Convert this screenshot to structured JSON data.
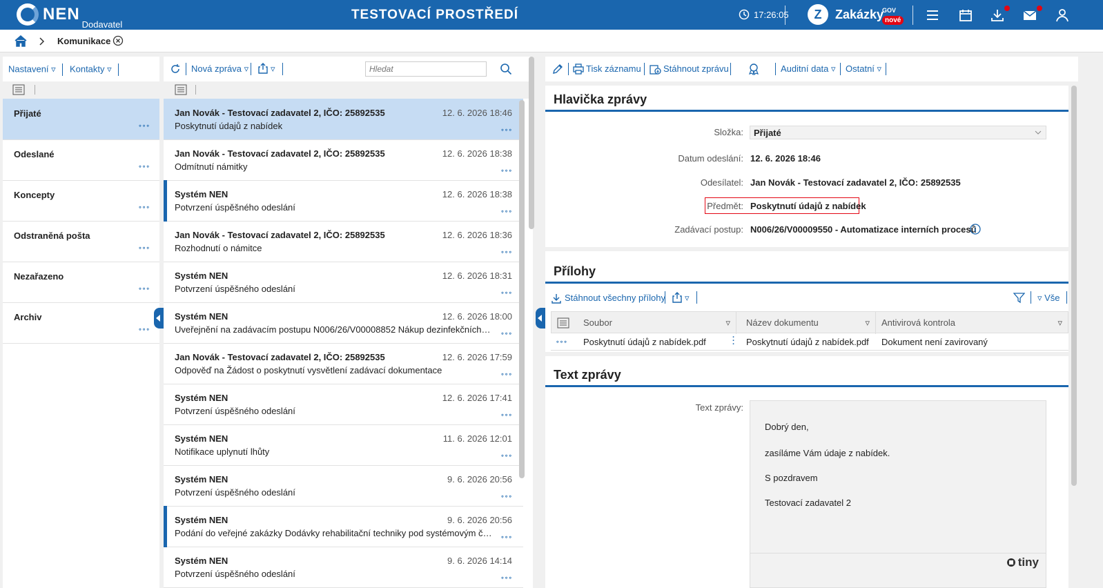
{
  "header": {
    "logo_text": "NEN",
    "logo_sub": "Dodavatel",
    "env_title": "TESTOVACÍ PROSTŘEDÍ",
    "clock": "17:26:05",
    "zakazky_text": "Zakázky",
    "zakazky_gov": "GOV",
    "zakazky_badge": "nové"
  },
  "breadcrumb": {
    "current": "Komunikace"
  },
  "left": {
    "toolbar": {
      "settings": "Nastavení",
      "contacts": "Kontakty"
    },
    "folders": [
      {
        "label": "Přijaté"
      },
      {
        "label": "Odeslané"
      },
      {
        "label": "Koncepty"
      },
      {
        "label": "Odstraněná pošta"
      },
      {
        "label": "Nezařazeno"
      },
      {
        "label": "Archiv"
      }
    ],
    "dots": "∘∘∘"
  },
  "middle": {
    "toolbar": {
      "new_message": "Nová zpráva",
      "search_placeholder": "Hledat"
    },
    "messages": [
      {
        "sender": "Jan Novák - Testovací zadavatel 2, IČO: 25892535",
        "date": "12. 6. 2026 18:46",
        "subject": "Poskytnutí údajů z nabídek"
      },
      {
        "sender": "Jan Novák - Testovací zadavatel 2, IČO: 25892535",
        "date": "12. 6. 2026 18:38",
        "subject": "Odmítnutí námitky"
      },
      {
        "sender": "Systém NEN",
        "date": "12. 6. 2026 18:38",
        "subject": "Potvrzení úspěšného odeslání"
      },
      {
        "sender": "Jan Novák - Testovací zadavatel 2, IČO: 25892535",
        "date": "12. 6. 2026 18:36",
        "subject": "Rozhodnutí o námitce"
      },
      {
        "sender": "Systém NEN",
        "date": "12. 6. 2026 18:31",
        "subject": "Potvrzení úspěšného odeslání"
      },
      {
        "sender": "Systém NEN",
        "date": "12. 6. 2026 18:00",
        "subject": "Uveřejnění na zadávacím postupu N006/26/V00008852 Nákup dezinfekčních prostředků"
      },
      {
        "sender": "Jan Novák - Testovací zadavatel 2, IČO: 25892535",
        "date": "12. 6. 2026 17:59",
        "subject": "Odpověď na Žádost o poskytnutí vysvětlení zadávací dokumentace"
      },
      {
        "sender": "Systém NEN",
        "date": "12. 6. 2026 17:41",
        "subject": "Potvrzení úspěšného odeslání"
      },
      {
        "sender": "Systém NEN",
        "date": "11. 6. 2026 12:01",
        "subject": "Notifikace uplynutí lhůty"
      },
      {
        "sender": "Systém NEN",
        "date": "9. 6. 2026 20:56",
        "subject": "Potvrzení úspěšného odeslání"
      },
      {
        "sender": "Systém NEN",
        "date": "9. 6. 2026 20:56",
        "subject": "Podání do veřejné zakázky Dodávky rehabilitační techniky pod systémovým číslem"
      },
      {
        "sender": "Systém NEN",
        "date": "9. 6. 2026 14:14",
        "subject": "Potvrzení úspěšného odeslání"
      }
    ]
  },
  "right": {
    "toolbar": {
      "print": "Tisk záznamu",
      "download": "Stáhnout zprávu",
      "audit": "Auditní data",
      "other": "Ostatní"
    },
    "header_section": {
      "title": "Hlavička zprávy",
      "folder_label": "Složka:",
      "folder_value": "Přijaté",
      "date_label": "Datum odeslání:",
      "date_value": "12. 6. 2026 18:46",
      "sender_label": "Odesílatel:",
      "sender_value": "Jan Novák - Testovací zadavatel 2, IČO: 25892535",
      "subject_label": "Předmět:",
      "subject_value": "Poskytnutí údajů z nabídek",
      "procedure_label": "Zadávací postup:",
      "procedure_value": "N006/26/V00009550 - Automatizace interních procesů"
    },
    "attachments": {
      "title": "Přílohy",
      "download_all": "Stáhnout všechny přílohy",
      "all": "Vše",
      "columns": [
        "Soubor",
        "Název dokumentu",
        "Antivirová kontrola"
      ],
      "rows": [
        {
          "file": "Poskytnutí údajů z nabídek.pdf",
          "name": "Poskytnutí údajů z nabídek.pdf",
          "av": "Dokument není zavirovaný"
        }
      ]
    },
    "text_section": {
      "title": "Text zprávy",
      "label": "Text zprávy:",
      "lines": [
        "Dobrý den,",
        "zasíláme Vám údaje z nabídek.",
        "S pozdravem",
        "Testovací zadavatel 2"
      ],
      "editor_brand": "tiny"
    }
  },
  "colors": {
    "primary": "#1a66ae",
    "selected": "#c6dcf3",
    "highlight_border": "#e30613"
  }
}
